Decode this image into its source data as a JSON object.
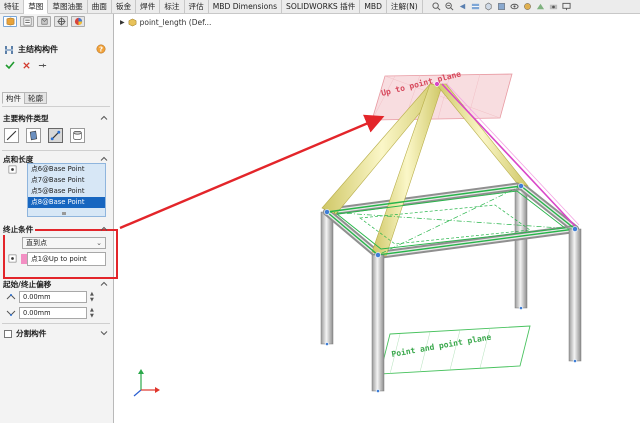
{
  "command_tabs": [
    "特征",
    "草图",
    "草图油墨",
    "曲面",
    "钣金",
    "焊件",
    "标注",
    "评估",
    "MBD Dimensions",
    "SOLIDWORKS 插件",
    "MBD",
    "注解(N)"
  ],
  "active_tab_index": 1,
  "tree_node": "point_length (Def...",
  "panel": {
    "title": "主结构构件",
    "tabs": [
      "构件",
      "轮廓"
    ],
    "sections": {
      "type": "主要构件类型",
      "points": "点和长度",
      "end_condition": "终止条件",
      "offset": "起始/终止偏移",
      "split": "分割构件"
    },
    "point_list": [
      "点6@Base Point",
      "点7@Base Point",
      "点5@Base Point",
      "点8@Base Point"
    ],
    "selected_point_index": 3,
    "end_condition_value": "直到点",
    "end_point_value": "点1@Up to point",
    "offset_start": "0.00mm",
    "offset_end": "0.00mm"
  },
  "annotations": {
    "up_to_point_plane": "Up to point plane",
    "point_and_point_plane": "Point and point plane"
  },
  "colors": {
    "highlight_red": "#e3252a",
    "selection_blue": "#1766c0",
    "frame_green": "#27b54a",
    "member_yellow": "#f0ea9c",
    "plane_pink": "#f4c6cc"
  }
}
